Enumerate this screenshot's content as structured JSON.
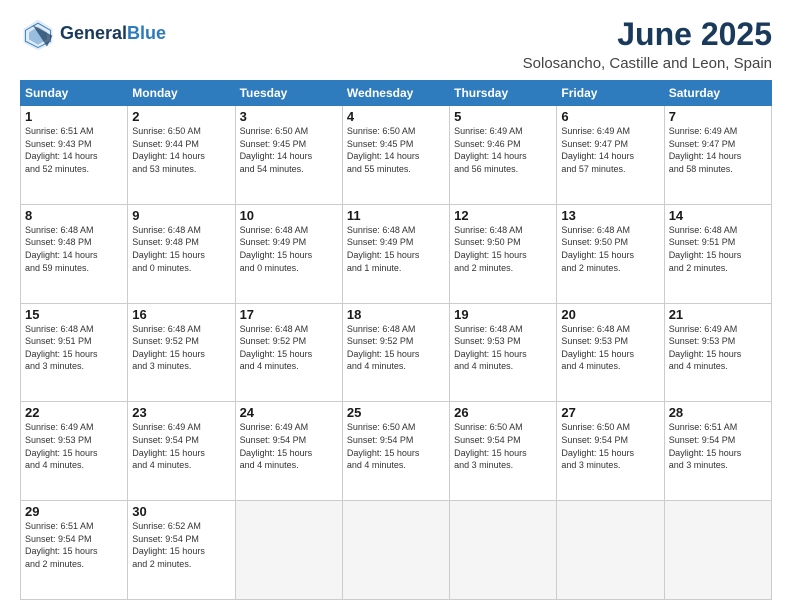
{
  "header": {
    "logo_line1": "General",
    "logo_line2": "Blue",
    "title": "June 2025",
    "subtitle": "Solosancho, Castille and Leon, Spain"
  },
  "days_of_week": [
    "Sunday",
    "Monday",
    "Tuesday",
    "Wednesday",
    "Thursday",
    "Friday",
    "Saturday"
  ],
  "weeks": [
    [
      {
        "day": 1,
        "info": "Sunrise: 6:51 AM\nSunset: 9:43 PM\nDaylight: 14 hours\nand 52 minutes."
      },
      {
        "day": 2,
        "info": "Sunrise: 6:50 AM\nSunset: 9:44 PM\nDaylight: 14 hours\nand 53 minutes."
      },
      {
        "day": 3,
        "info": "Sunrise: 6:50 AM\nSunset: 9:45 PM\nDaylight: 14 hours\nand 54 minutes."
      },
      {
        "day": 4,
        "info": "Sunrise: 6:50 AM\nSunset: 9:45 PM\nDaylight: 14 hours\nand 55 minutes."
      },
      {
        "day": 5,
        "info": "Sunrise: 6:49 AM\nSunset: 9:46 PM\nDaylight: 14 hours\nand 56 minutes."
      },
      {
        "day": 6,
        "info": "Sunrise: 6:49 AM\nSunset: 9:47 PM\nDaylight: 14 hours\nand 57 minutes."
      },
      {
        "day": 7,
        "info": "Sunrise: 6:49 AM\nSunset: 9:47 PM\nDaylight: 14 hours\nand 58 minutes."
      }
    ],
    [
      {
        "day": 8,
        "info": "Sunrise: 6:48 AM\nSunset: 9:48 PM\nDaylight: 14 hours\nand 59 minutes."
      },
      {
        "day": 9,
        "info": "Sunrise: 6:48 AM\nSunset: 9:48 PM\nDaylight: 15 hours\nand 0 minutes."
      },
      {
        "day": 10,
        "info": "Sunrise: 6:48 AM\nSunset: 9:49 PM\nDaylight: 15 hours\nand 0 minutes."
      },
      {
        "day": 11,
        "info": "Sunrise: 6:48 AM\nSunset: 9:49 PM\nDaylight: 15 hours\nand 1 minute."
      },
      {
        "day": 12,
        "info": "Sunrise: 6:48 AM\nSunset: 9:50 PM\nDaylight: 15 hours\nand 2 minutes."
      },
      {
        "day": 13,
        "info": "Sunrise: 6:48 AM\nSunset: 9:50 PM\nDaylight: 15 hours\nand 2 minutes."
      },
      {
        "day": 14,
        "info": "Sunrise: 6:48 AM\nSunset: 9:51 PM\nDaylight: 15 hours\nand 2 minutes."
      }
    ],
    [
      {
        "day": 15,
        "info": "Sunrise: 6:48 AM\nSunset: 9:51 PM\nDaylight: 15 hours\nand 3 minutes."
      },
      {
        "day": 16,
        "info": "Sunrise: 6:48 AM\nSunset: 9:52 PM\nDaylight: 15 hours\nand 3 minutes."
      },
      {
        "day": 17,
        "info": "Sunrise: 6:48 AM\nSunset: 9:52 PM\nDaylight: 15 hours\nand 4 minutes."
      },
      {
        "day": 18,
        "info": "Sunrise: 6:48 AM\nSunset: 9:52 PM\nDaylight: 15 hours\nand 4 minutes."
      },
      {
        "day": 19,
        "info": "Sunrise: 6:48 AM\nSunset: 9:53 PM\nDaylight: 15 hours\nand 4 minutes."
      },
      {
        "day": 20,
        "info": "Sunrise: 6:48 AM\nSunset: 9:53 PM\nDaylight: 15 hours\nand 4 minutes."
      },
      {
        "day": 21,
        "info": "Sunrise: 6:49 AM\nSunset: 9:53 PM\nDaylight: 15 hours\nand 4 minutes."
      }
    ],
    [
      {
        "day": 22,
        "info": "Sunrise: 6:49 AM\nSunset: 9:53 PM\nDaylight: 15 hours\nand 4 minutes."
      },
      {
        "day": 23,
        "info": "Sunrise: 6:49 AM\nSunset: 9:54 PM\nDaylight: 15 hours\nand 4 minutes."
      },
      {
        "day": 24,
        "info": "Sunrise: 6:49 AM\nSunset: 9:54 PM\nDaylight: 15 hours\nand 4 minutes."
      },
      {
        "day": 25,
        "info": "Sunrise: 6:50 AM\nSunset: 9:54 PM\nDaylight: 15 hours\nand 4 minutes."
      },
      {
        "day": 26,
        "info": "Sunrise: 6:50 AM\nSunset: 9:54 PM\nDaylight: 15 hours\nand 3 minutes."
      },
      {
        "day": 27,
        "info": "Sunrise: 6:50 AM\nSunset: 9:54 PM\nDaylight: 15 hours\nand 3 minutes."
      },
      {
        "day": 28,
        "info": "Sunrise: 6:51 AM\nSunset: 9:54 PM\nDaylight: 15 hours\nand 3 minutes."
      }
    ],
    [
      {
        "day": 29,
        "info": "Sunrise: 6:51 AM\nSunset: 9:54 PM\nDaylight: 15 hours\nand 2 minutes."
      },
      {
        "day": 30,
        "info": "Sunrise: 6:52 AM\nSunset: 9:54 PM\nDaylight: 15 hours\nand 2 minutes."
      },
      null,
      null,
      null,
      null,
      null
    ]
  ]
}
